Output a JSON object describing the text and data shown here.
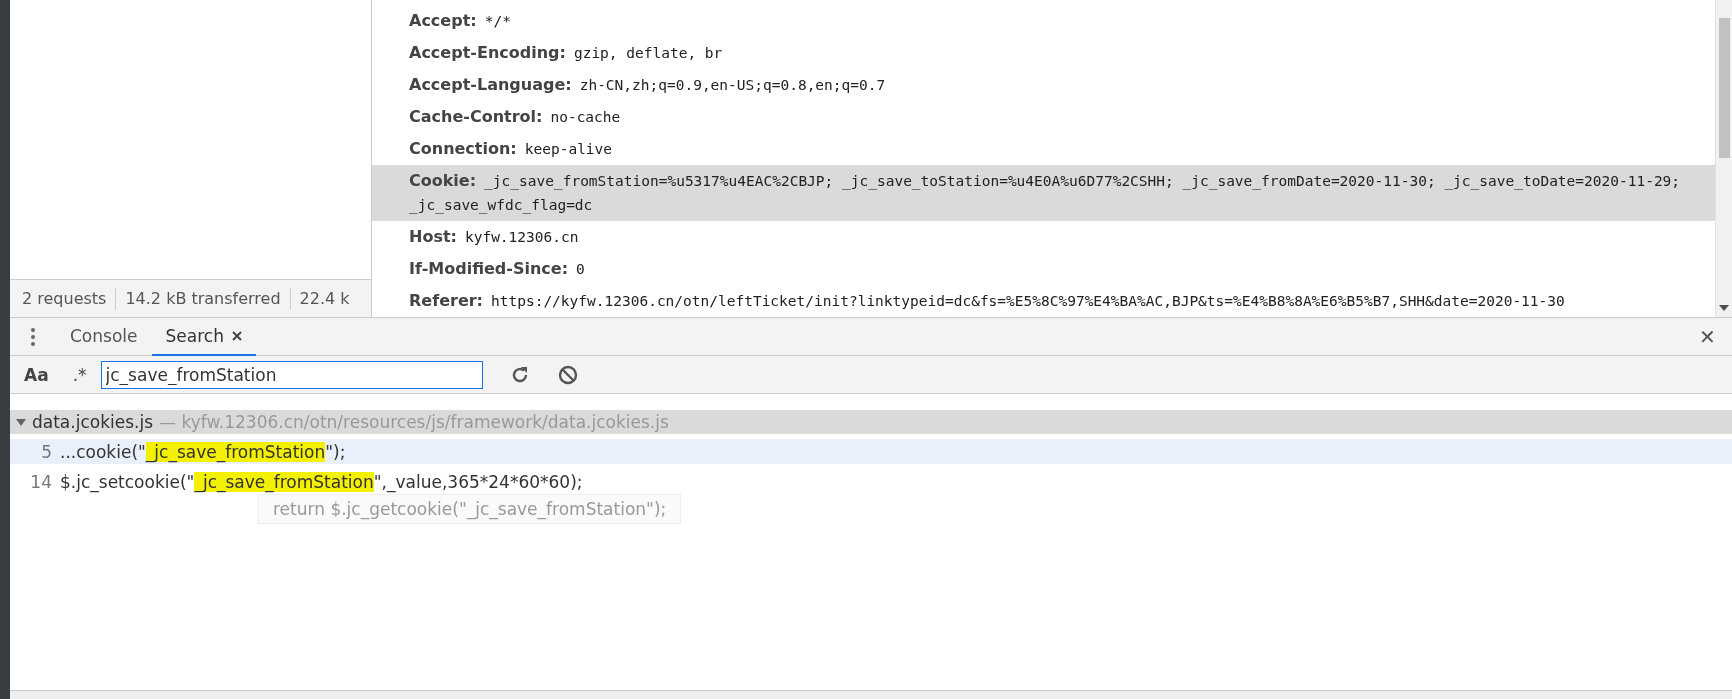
{
  "network_summary": [
    "2 requests",
    "14.2 kB transferred",
    "22.4 k"
  ],
  "request_headers": [
    {
      "name": "Accept:",
      "value": "*/*",
      "selected": false
    },
    {
      "name": "Accept-Encoding:",
      "value": "gzip, deflate, br",
      "selected": false
    },
    {
      "name": "Accept-Language:",
      "value": "zh-CN,zh;q=0.9,en-US;q=0.8,en;q=0.7",
      "selected": false
    },
    {
      "name": "Cache-Control:",
      "value": "no-cache",
      "selected": false
    },
    {
      "name": "Connection:",
      "value": "keep-alive",
      "selected": false
    },
    {
      "name": "Cookie:",
      "value": "_jc_save_fromStation=%u5317%u4EAC%2CBJP; _jc_save_toStation=%u4E0A%u6D77%2CSHH; _jc_save_fromDate=2020-11-30; _jc_save_toDate=2020-11-29; _jc_save_wfdc_flag=dc",
      "selected": true
    },
    {
      "name": "Host:",
      "value": "kyfw.12306.cn",
      "selected": false
    },
    {
      "name": "If-Modified-Since:",
      "value": "0",
      "selected": false
    },
    {
      "name": "Referer:",
      "value": "https://kyfw.12306.cn/otn/leftTicket/init?linktypeid=dc&fs=%E5%8C%97%E4%BA%AC,BJP&ts=%E4%B8%8A%E6%B5%B7,SHH&date=2020-11-30",
      "selected": false
    }
  ],
  "drawer_tabs": [
    {
      "label": "Console",
      "selected": false,
      "closable": false
    },
    {
      "label": "Search",
      "selected": true,
      "closable": true
    }
  ],
  "drawer_close": "✕",
  "search": {
    "match_case": "Aa",
    "regex": ".*",
    "value": "jc_save_fromStation"
  },
  "results": {
    "file": "data.jcokies.js",
    "separator": "—",
    "path": "kyfw.12306.cn/otn/resources/js/framework/data.jcokies.js",
    "expanded": true,
    "lines": [
      {
        "line_number": "5",
        "before": "...cookie(\"",
        "match": "_jc_save_fromStation",
        "after": "\");",
        "selected": true
      },
      {
        "line_number": "14",
        "before": "$.jc_setcookie(\"",
        "match": "_jc_save_fromStation",
        "after": "\",_value,365*24*60*60);",
        "selected": false
      }
    ],
    "tooltip": "return $.jc_getcookie(\"_jc_save_fromStation\");"
  }
}
